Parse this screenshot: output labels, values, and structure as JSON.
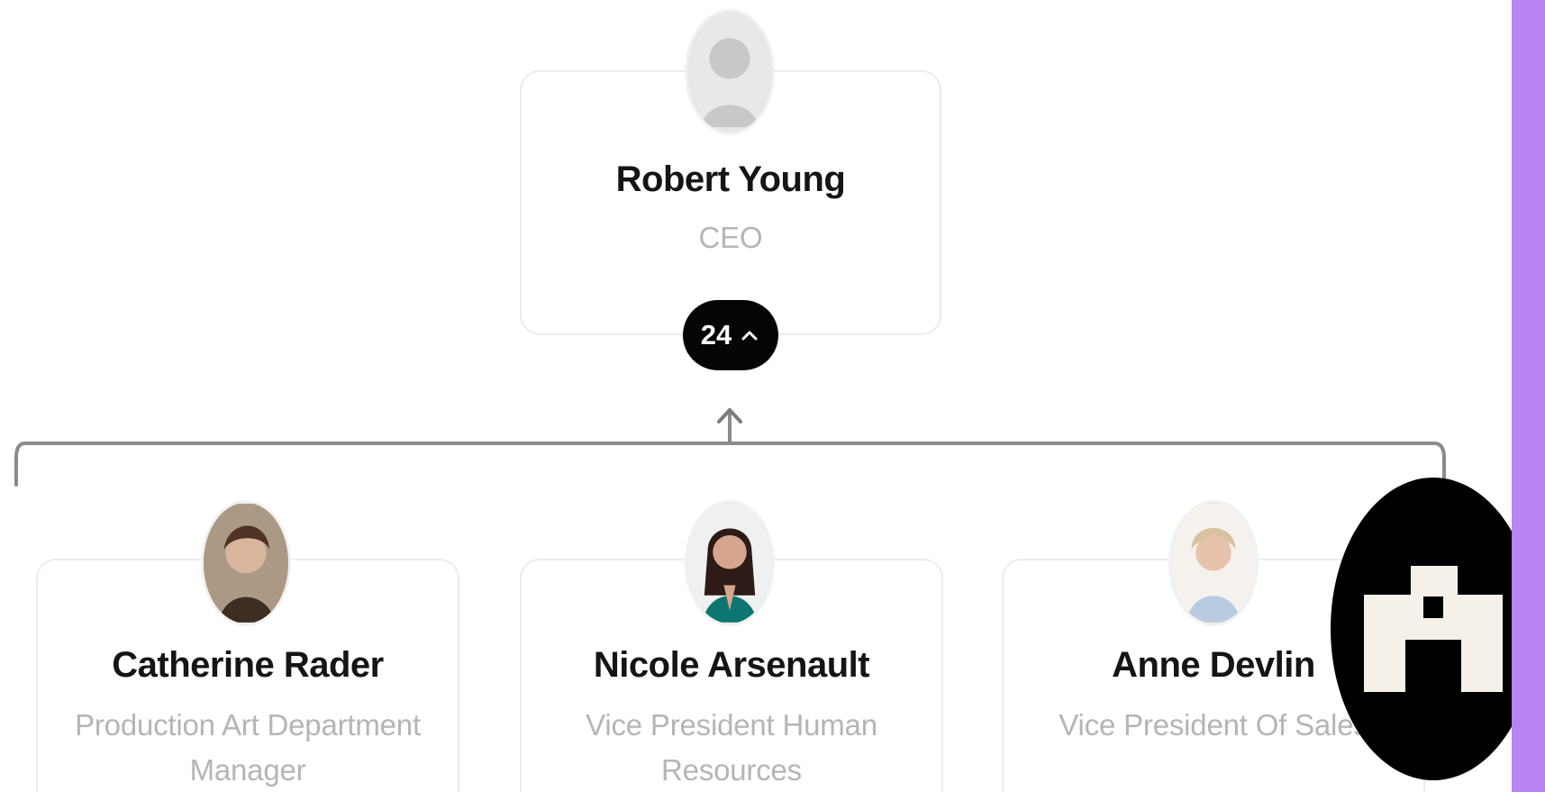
{
  "root": {
    "name": "Robert Young",
    "role": "CEO",
    "expand_count": "24",
    "avatar_icon": "user-placeholder-icon"
  },
  "children": [
    {
      "name": "Catherine Rader",
      "role": "Production Art Department Manager",
      "avatar_icon": "person-photo-icon"
    },
    {
      "name": "Nicole Arsenault",
      "role": "Vice President Human Resources",
      "avatar_icon": "person-photo-icon"
    },
    {
      "name": "Anne Devlin",
      "role": "Vice President Of Sales",
      "avatar_icon": "person-photo-icon"
    }
  ],
  "colors": {
    "accent_panel": "#b884f4",
    "card_border": "#ececec",
    "name_text": "#151515",
    "role_text": "#b5b5b5",
    "pill_bg": "#050505",
    "badge_bg": "#000000",
    "badge_mark": "#f6f1e8"
  },
  "icons": {
    "expand_icon": "chevron-up-icon",
    "floating_badge_icon": "brand-logo-icon"
  }
}
